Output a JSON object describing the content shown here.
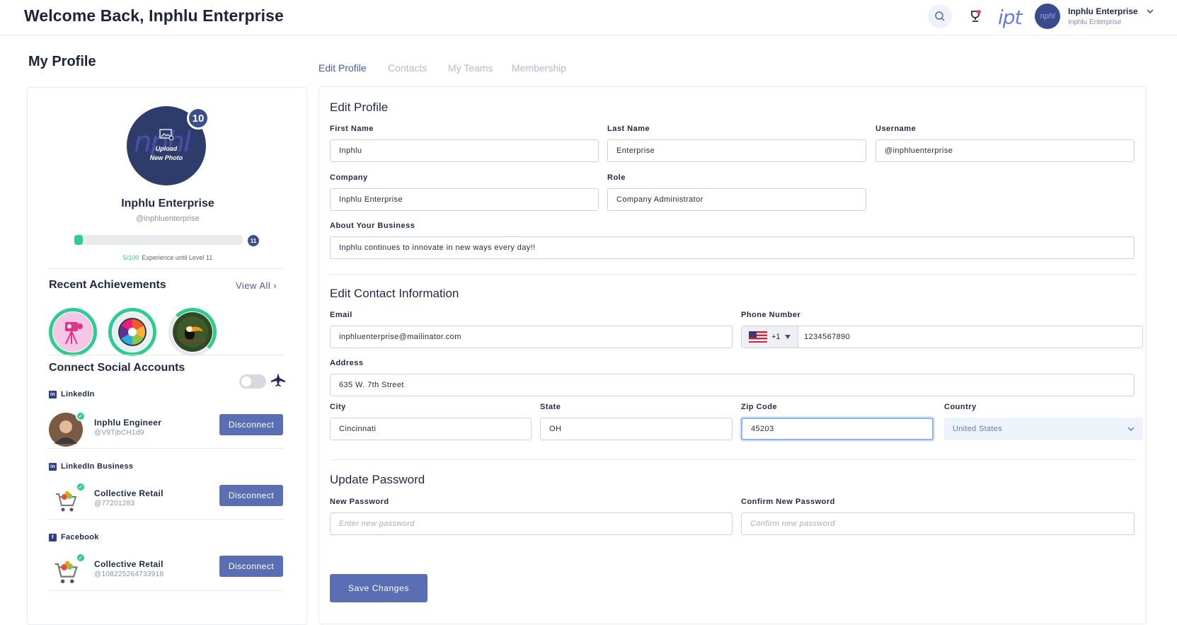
{
  "header": {
    "welcome": "Welcome Back, Inphlu Enterprise",
    "logo_text": "ipt",
    "avatar_text": "nphl",
    "user_name": "Inphlu Enterprise",
    "user_sub": "Inphlu Enterprise"
  },
  "page_title": "My Profile",
  "profile": {
    "avatar_watermark": "nphl",
    "upload_line1": "Upload",
    "upload_line2": "New Photo",
    "level": "10",
    "name": "Inphlu Enterprise",
    "handle": "@inphluenterprise",
    "xp_fraction": 0.05,
    "next_level": "11",
    "xp_current": "5/100",
    "xp_text": "Experience until Level 11"
  },
  "achievements": {
    "title": "Recent Achievements",
    "view_all": "View All ›"
  },
  "social": {
    "title": "Connect Social Accounts",
    "accounts": [
      {
        "network": "LinkedIn",
        "name": "Inphlu Engineer",
        "id": "@V9TjbCH1d9",
        "button": "Disconnect"
      },
      {
        "network": "LinkedIn Business",
        "name": "Collective Retail",
        "id": "@77201283",
        "button": "Disconnect"
      },
      {
        "network": "Facebook",
        "name": "Collective Retail",
        "id": "@108225264733918",
        "button": "Disconnect"
      }
    ]
  },
  "tabs": [
    "Edit Profile",
    "Contacts",
    "My Teams",
    "Membership"
  ],
  "edit_profile": {
    "heading": "Edit Profile",
    "first_name_label": "First Name",
    "first_name": "Inphlu",
    "last_name_label": "Last Name",
    "last_name": "Enterprise",
    "username_label": "Username",
    "username": "@inphluenterprise",
    "company_label": "Company",
    "company": "Inphlu Enterprise",
    "role_label": "Role",
    "role": "Company Administrator",
    "about_label": "About Your Business",
    "about": "Inphlu continues to innovate in new ways every day!!"
  },
  "contact": {
    "heading": "Edit Contact Information",
    "email_label": "Email",
    "email": "inphluenterprise@mailinator.com",
    "phone_label": "Phone Number",
    "phone_code": "+1",
    "phone": "1234567890",
    "address_label": "Address",
    "address": "635 W. 7th Street",
    "city_label": "City",
    "city": "Cincinnati",
    "state_label": "State",
    "state": "OH",
    "zip_label": "Zip Code",
    "zip": "45203",
    "country_label": "Country",
    "country": "United States"
  },
  "password": {
    "heading": "Update Password",
    "new_label": "New Password",
    "new_placeholder": "Enter new password",
    "confirm_label": "Confirm New Password",
    "confirm_placeholder": "Confirm new password",
    "save": "Save Changes"
  },
  "colors": {
    "accent": "#5a6eb4",
    "success": "#2ecc8f",
    "navy": "#2e3c6c"
  }
}
